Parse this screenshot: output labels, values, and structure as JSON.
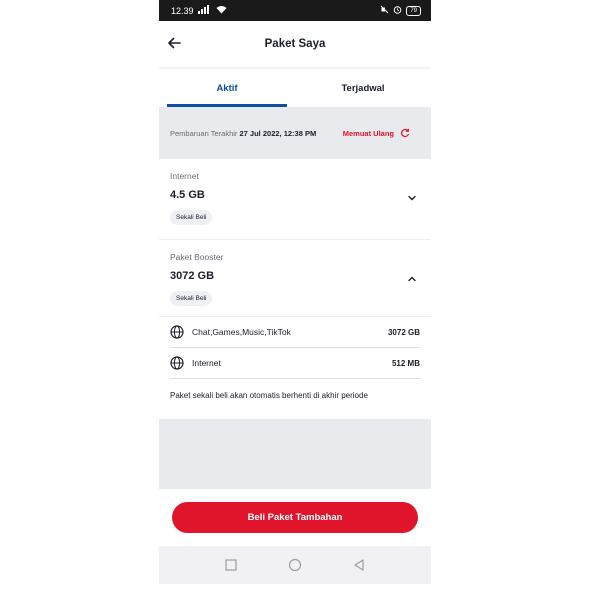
{
  "status_bar": {
    "time": "12.39",
    "battery": "79"
  },
  "header": {
    "title": "Paket Saya"
  },
  "tabs": [
    {
      "label": "Aktif"
    },
    {
      "label": "Terjadwal"
    }
  ],
  "update": {
    "label": "Pembaruan Terakhir",
    "date": "27 Jul 2022, 12:38 PM",
    "reload_label": "Memuat Ulang"
  },
  "packages": [
    {
      "label": "Internet",
      "value": "4.5 GB",
      "chip": "Sekali Beli"
    },
    {
      "label": "Paket Booster",
      "value": "3072 GB",
      "chip": "Sekali Beli"
    }
  ],
  "details": [
    {
      "name": "Chat,Games,Music,TikTok",
      "size": "3072 GB",
      "icon": "globe-icon"
    },
    {
      "name": "Internet",
      "size": "512 MB",
      "icon": "globe-icon"
    }
  ],
  "note": "Paket sekali beli akan otomatis berhenti di akhir periode",
  "buy_button": "Beli Paket Tambahan",
  "colors": {
    "primary_blue": "#0e4fa3",
    "accent_red": "#e0142b"
  }
}
